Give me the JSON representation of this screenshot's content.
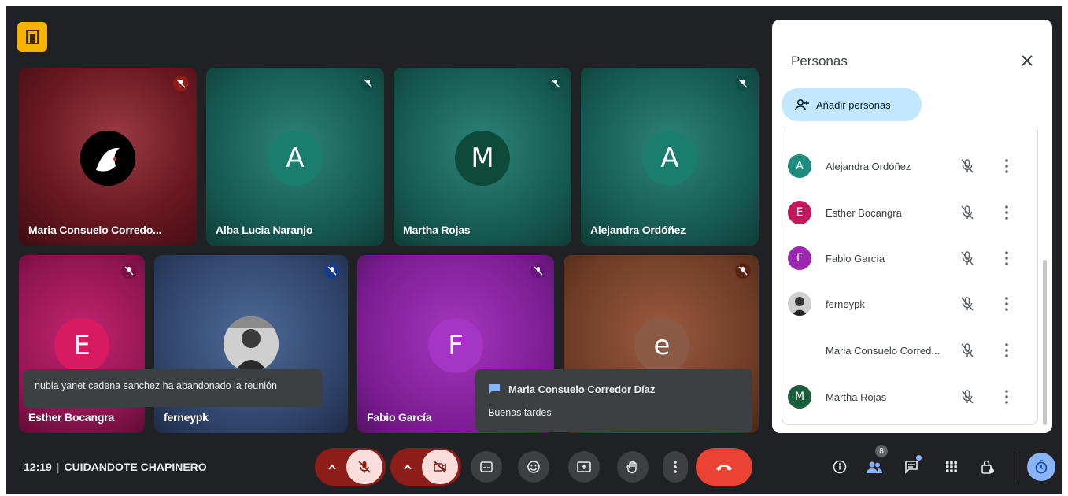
{
  "tiles": [
    {
      "name": "Maria Consuelo Corredo...",
      "initial": "",
      "color": "#7a1f24"
    },
    {
      "name": "Alba Lucia Naranjo",
      "initial": "A",
      "color": "#14695e"
    },
    {
      "name": "Martha Rojas",
      "initial": "M",
      "color": "#14695e"
    },
    {
      "name": "Alejandra Ordóñez",
      "initial": "A",
      "color": "#14695e"
    },
    {
      "name": "Esther Bocangra",
      "initial": "E",
      "color": "#a4155e"
    },
    {
      "name": "ferneypk",
      "initial": "",
      "color": "#33476e"
    },
    {
      "name": "Fabio García",
      "initial": "F",
      "color": "#8a1fa3"
    },
    {
      "name": "",
      "initial": "e",
      "color": "#7b3f28"
    }
  ],
  "toasts": {
    "left_leave": "nubia yanet cadena sanchez ha abandonado la reunión",
    "chat_sender": "Maria Consuelo Corredor Díaz",
    "chat_message": "Buenas tardes"
  },
  "bottom": {
    "time": "12:19",
    "meeting_name": "CUIDANDOTE CHAPINERO",
    "people_count": "8"
  },
  "panel": {
    "title": "Personas",
    "add_label": "Añadir personas",
    "people": [
      {
        "name": "Alejandra Ordóñez",
        "initial": "A",
        "color": "#1e8c7e"
      },
      {
        "name": "Esther Bocangra",
        "initial": "E",
        "color": "#c2185b"
      },
      {
        "name": "Fabio García",
        "initial": "F",
        "color": "#9c27b0"
      },
      {
        "name": "ferneypk",
        "initial": "",
        "color": "#555555"
      },
      {
        "name": "Maria Consuelo Corred...",
        "initial": "",
        "color": "#ffffff"
      },
      {
        "name": "Martha Rojas",
        "initial": "M",
        "color": "#1b5e3b"
      }
    ]
  },
  "colors": {
    "background": "#202124",
    "leave_red": "#ea4335",
    "panel_accent": "#c2e7ff"
  }
}
